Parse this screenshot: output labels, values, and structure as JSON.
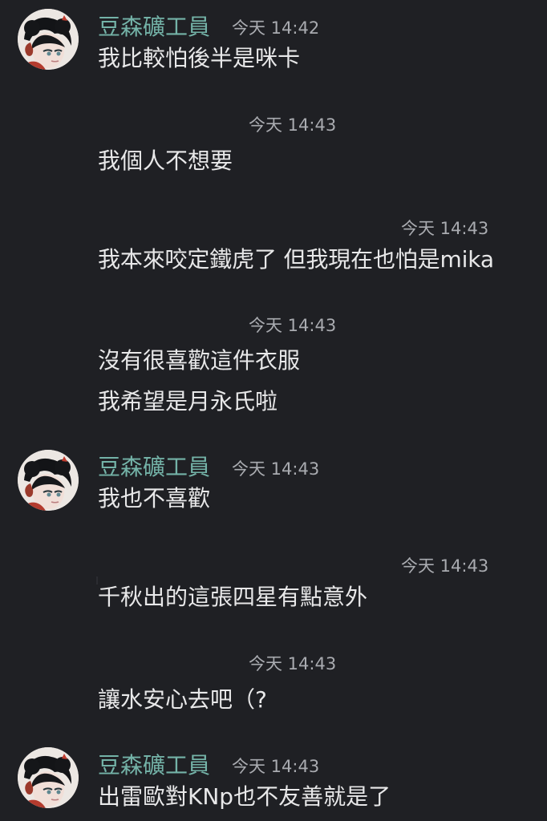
{
  "messages": [
    {
      "author": "豆森礦工員",
      "time": "今天 14:42",
      "text": "我比較怕後半是咪卡"
    },
    {
      "time": "今天 14:43",
      "text": "我個人不想要"
    },
    {
      "time": "今天 14:43",
      "text": "我本來咬定鐵虎了 但我現在也怕是mika"
    },
    {
      "time": "今天 14:43",
      "text": "沒有很喜歡這件衣服"
    },
    {
      "text": "我希望是月永氏啦"
    },
    {
      "author": "豆森礦工員",
      "time": "今天 14:43",
      "text": "我也不喜歡"
    },
    {
      "time": "今天 14:43",
      "text": "千秋出的這張四星有點意外"
    },
    {
      "time": "今天 14:43",
      "text": "讓水安心去吧（?"
    },
    {
      "author": "豆森礦工員",
      "time": "今天 14:43",
      "text": "出雷歐對KNp也不友善就是了"
    }
  ]
}
